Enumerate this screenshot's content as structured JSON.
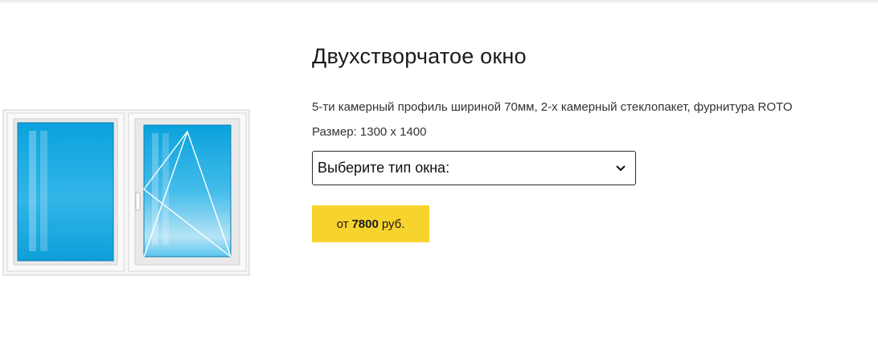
{
  "product": {
    "title": "Двухстворчатое окно",
    "description": "5-ти камерный профиль шириной 70мм, 2-х камерный стеклопакет, фурнитура ROTO",
    "size": "Размер: 1300 х 1400",
    "type_select": {
      "selected": "Выберите тип окна:"
    },
    "price": {
      "prefix": "от",
      "value": "7800",
      "currency": "руб."
    }
  },
  "colors": {
    "button_bg": "#f7d32e",
    "glass": "#1aa8e0",
    "frame": "#f4f4f4"
  }
}
